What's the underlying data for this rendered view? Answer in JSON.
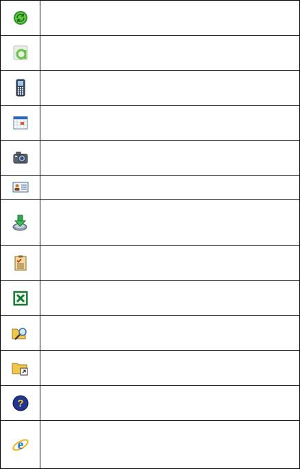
{
  "rows": [
    {
      "icon": "sync-icon",
      "description": ""
    },
    {
      "icon": "app-a-icon",
      "description": ""
    },
    {
      "icon": "phone-icon",
      "description": ""
    },
    {
      "icon": "calendar-window-icon",
      "description": ""
    },
    {
      "icon": "camera-icon",
      "description": ""
    },
    {
      "icon": "contact-card-icon",
      "description": ""
    },
    {
      "icon": "install-download-icon",
      "description": ""
    },
    {
      "icon": "task-checklist-icon",
      "description": ""
    },
    {
      "icon": "excel-icon",
      "description": ""
    },
    {
      "icon": "folder-search-icon",
      "description": ""
    },
    {
      "icon": "folder-shortcut-icon",
      "description": ""
    },
    {
      "icon": "help-icon",
      "description": ""
    },
    {
      "icon": "internet-explorer-icon",
      "description": ""
    }
  ]
}
